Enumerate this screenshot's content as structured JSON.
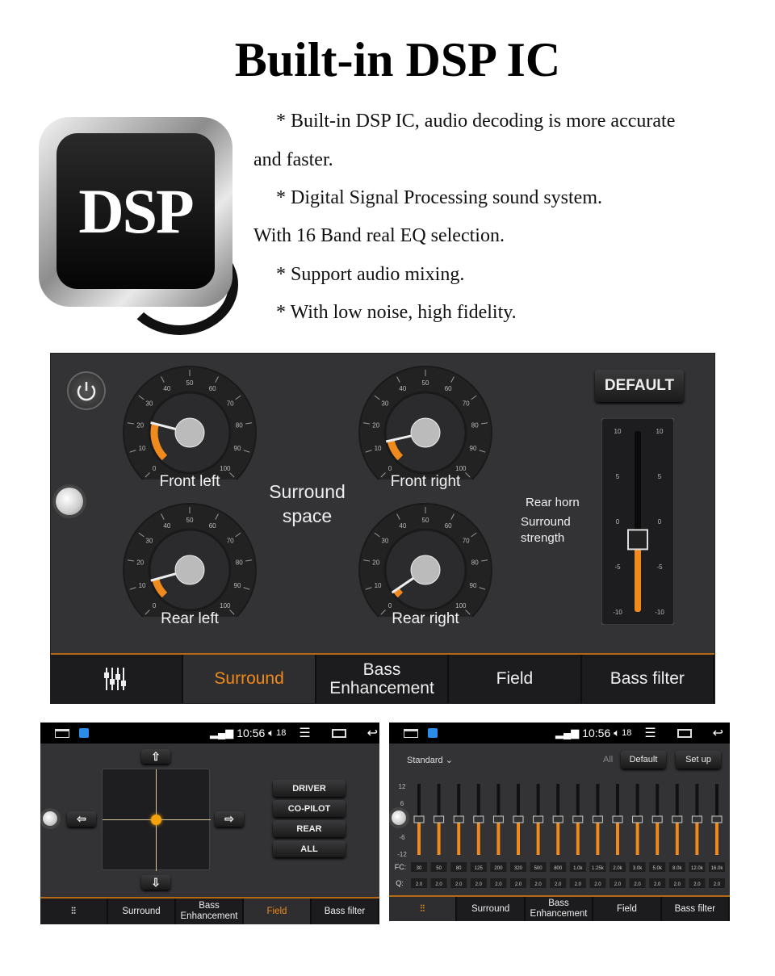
{
  "title": "Built-in DSP IC",
  "logo_text": "DSP",
  "description": [
    "* Built-in DSP IC, audio decoding is more accurate",
    "and faster.",
    "* Digital Signal Processing sound system.",
    "With 16 Band real EQ selection.",
    "* Support audio mixing.",
    "* With low noise, high fidelity."
  ],
  "surround": {
    "default_label": "DEFAULT",
    "center_label_1": "Surround",
    "center_label_2": "space",
    "gauges": [
      {
        "label": "Front left",
        "value": 22
      },
      {
        "label": "Front right",
        "value": 12
      },
      {
        "label": "Rear left",
        "value": 11
      },
      {
        "label": "Rear right",
        "value": 4
      }
    ],
    "gauge_ticks": [
      "0",
      "10",
      "20",
      "30",
      "40",
      "50",
      "60",
      "70",
      "80",
      "90",
      "100"
    ],
    "rear_horn_label": "Rear horn",
    "strength_label_1": "Surround",
    "strength_label_2": "strength",
    "strength_ticks": [
      "10",
      "5",
      "0",
      "-5",
      "-10"
    ],
    "strength_value": -2,
    "accent": "#f08a1c"
  },
  "tabs": {
    "eq_icon": "equalizer-icon",
    "surround": "Surround",
    "bass_1": "Bass",
    "bass_2": "Enhancement",
    "field": "Field",
    "bass_filter": "Bass filter"
  },
  "statusbar": {
    "time": "10:56",
    "volume": "18"
  },
  "field": {
    "buttons": [
      "DRIVER",
      "CO-PILOT",
      "REAR",
      "ALL"
    ]
  },
  "eq": {
    "preset": "Standard",
    "all_label": "All",
    "default_label": "Default",
    "setup_label": "Set up",
    "y_ticks": [
      "12",
      "6",
      "-6",
      "-12"
    ],
    "fc_label": "FC:",
    "q_label": "Q:",
    "fc": [
      "30",
      "50",
      "80",
      "125",
      "200",
      "320",
      "500",
      "800",
      "1.0k",
      "1.25k",
      "2.0k",
      "3.0k",
      "5.0k",
      "8.0k",
      "12.0k",
      "16.0k"
    ],
    "q": [
      "2.0",
      "2.0",
      "2.0",
      "2.0",
      "2.0",
      "2.0",
      "2.0",
      "2.0",
      "2.0",
      "2.0",
      "2.0",
      "2.0",
      "2.0",
      "2.0",
      "2.0",
      "2.0"
    ],
    "gains": [
      0,
      0,
      0,
      0,
      0,
      0,
      0,
      0,
      0,
      0,
      0,
      0,
      0,
      0,
      0,
      0
    ]
  }
}
